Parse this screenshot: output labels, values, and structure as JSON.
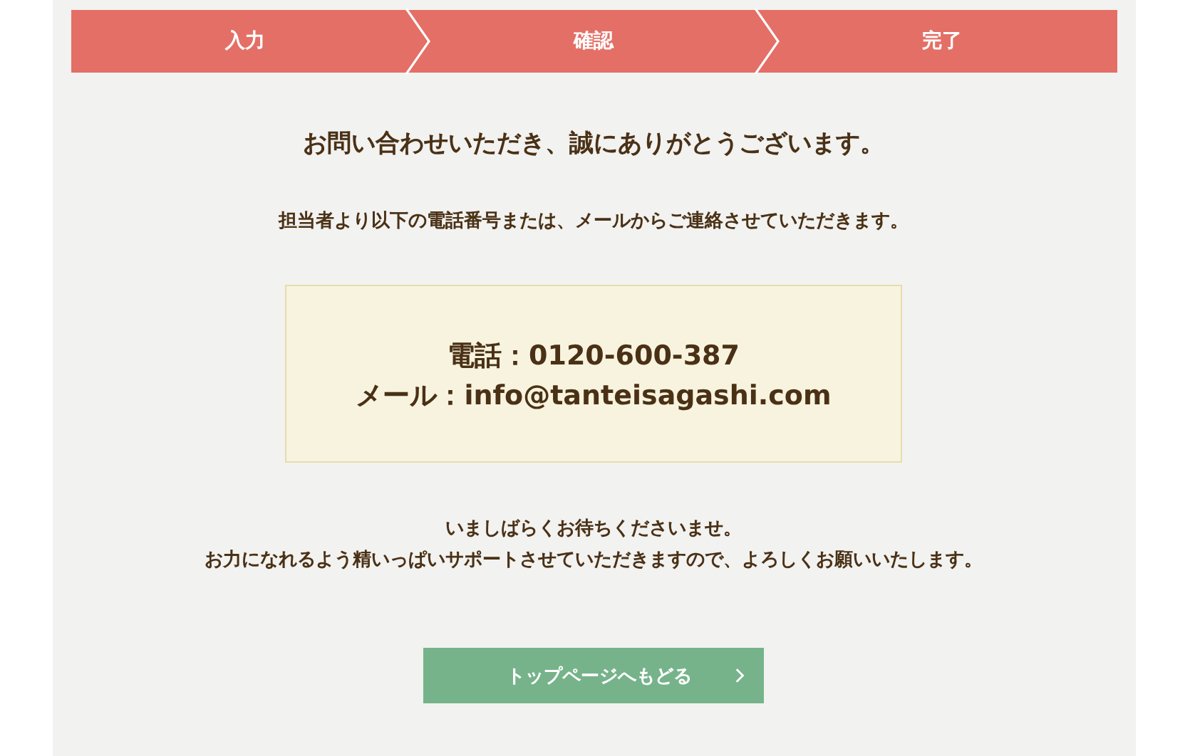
{
  "steps": [
    {
      "label": "入力"
    },
    {
      "label": "確認"
    },
    {
      "label": "完了"
    }
  ],
  "title": "お問い合わせいただき、誠にありがとうございます。",
  "lead": "担当者より以下の電話番号または、メールからご連絡させていただきます。",
  "contact": [
    "電話：0120-600-387",
    "メール：info@tanteisagashi.com"
  ],
  "closing": [
    "いましばらくお待ちくださいませ。",
    "お力になれるよう精いっぱいサポートさせていただきますので、よろしくお願いいたします。"
  ],
  "button": {
    "label": "トップページへもどる"
  }
}
